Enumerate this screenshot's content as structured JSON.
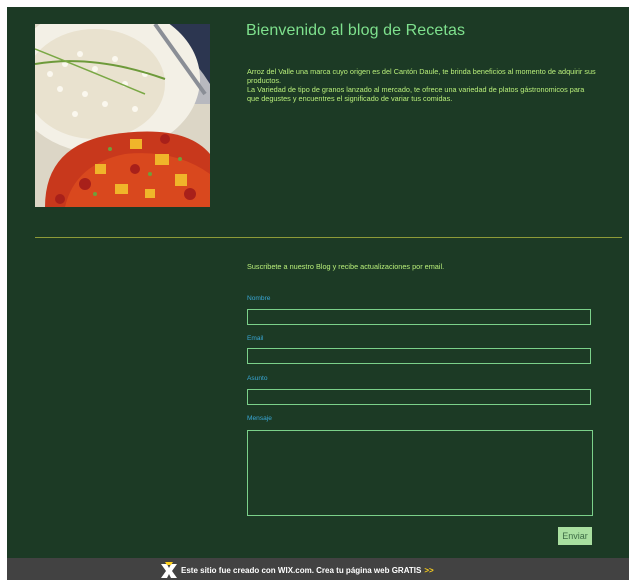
{
  "header": {
    "title": "Bienvenido al blog de Recetas",
    "intro_line_1": "Arroz del Valle una marca cuyo origen es del Cantón Daule, te brinda beneficios al momento de adquirir sus productos.",
    "intro_line_2": "La Variedad de tipo de granos lanzado al mercado, te ofrece una variedad de platos gástronomicos para que degustes y encuentres el significado de variar tus comidas."
  },
  "contact_form": {
    "subscribe_text": "Suscribete a nuestro Blog y recibe actualizaciones por email.",
    "name_label": "Nombre",
    "name_value": "",
    "email_label": "Email",
    "email_value": "",
    "subject_label": "Asunto",
    "subject_value": "",
    "message_label": "Mensaje",
    "message_value": "",
    "send_label": "Enviar"
  },
  "footer": {
    "text": "Este sitio fue creado con WIX.com. Crea tu página web GRATIS",
    "link": ">>"
  },
  "colors": {
    "background": "#1c3a25",
    "title": "#7ee08d",
    "body_text": "#b9ef7a",
    "label": "#39a7d6",
    "field_border": "#7bd08a",
    "divider": "#8d9a38",
    "footer_bar": "#424242",
    "footer_link": "#ffd21c"
  }
}
